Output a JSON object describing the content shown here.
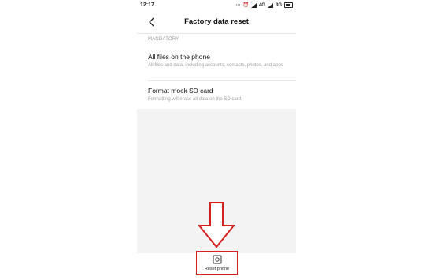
{
  "status_bar": {
    "time": "12:17",
    "net1": "4G",
    "net2": "3G"
  },
  "header": {
    "title": "Factory data reset"
  },
  "section": {
    "label": "MANDATORY"
  },
  "items": [
    {
      "title": "All files on the phone",
      "desc": "All files and data, including accounts, contacts, photos, and apps"
    },
    {
      "title": "Format mock SD card",
      "desc": "Formatting will erase all data on the SD card"
    }
  ],
  "bottom": {
    "reset_label": "Reset phone"
  },
  "colors": {
    "highlight": "#d61f1f",
    "background_grey": "#f3f3f3"
  },
  "annotation": {
    "arrow_icon": "down-arrow-icon"
  }
}
